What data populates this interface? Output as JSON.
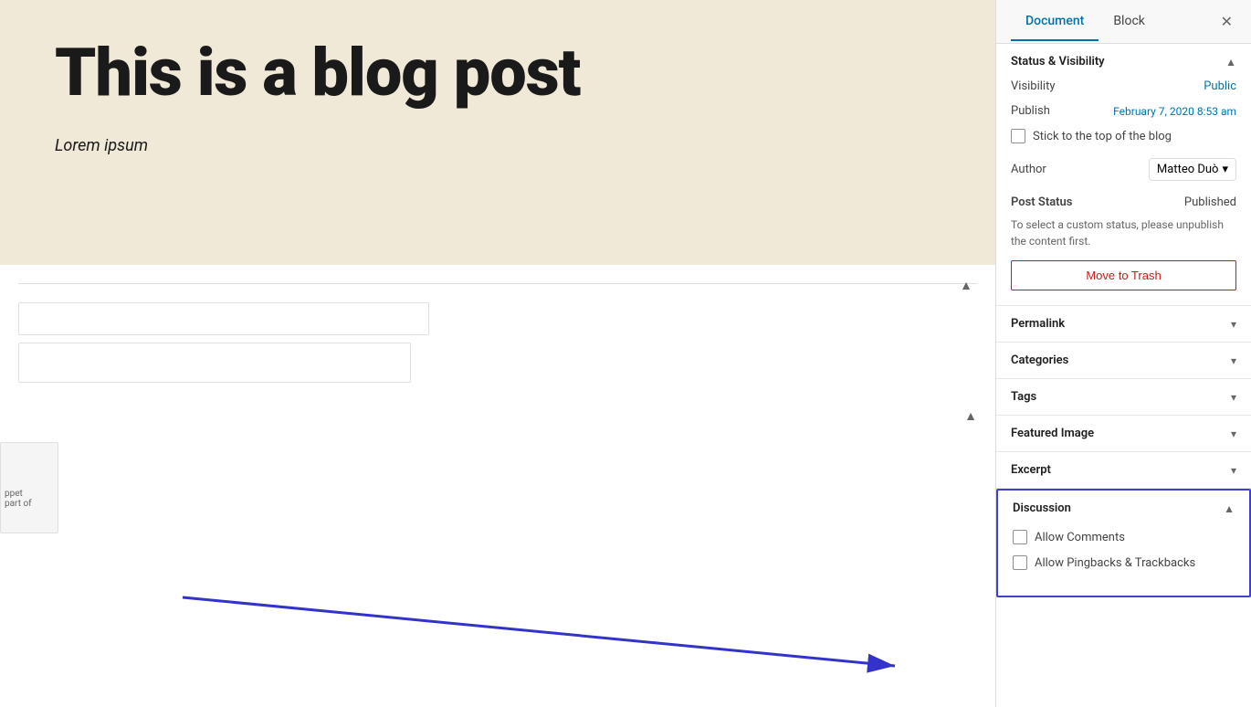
{
  "sidebar": {
    "tabs": [
      {
        "id": "document",
        "label": "Document",
        "active": true
      },
      {
        "id": "block",
        "label": "Block",
        "active": false
      }
    ],
    "close_label": "✕",
    "sections": {
      "status_visibility": {
        "title": "Status & Visibility",
        "expanded": true,
        "visibility_label": "Visibility",
        "visibility_value": "Public",
        "publish_label": "Publish",
        "publish_value": "February 7, 2020 8:53 am",
        "stick_to_top_label": "Stick to the top of the blog",
        "author_label": "Author",
        "author_value": "Matteo Duò",
        "post_status_label": "Post Status",
        "post_status_value": "Published",
        "custom_status_note": "To select a custom status, please unpublish the content first.",
        "move_to_trash_label": "Move to Trash"
      },
      "permalink": {
        "title": "Permalink",
        "expanded": false
      },
      "categories": {
        "title": "Categories",
        "expanded": false
      },
      "tags": {
        "title": "Tags",
        "expanded": false
      },
      "featured_image": {
        "title": "Featured Image",
        "expanded": false
      },
      "excerpt": {
        "title": "Excerpt",
        "expanded": false
      },
      "discussion": {
        "title": "Discussion",
        "expanded": true,
        "allow_comments_label": "Allow Comments",
        "allow_pingbacks_label": "Allow Pingbacks & Trackbacks"
      }
    }
  },
  "main": {
    "hero_title": "This is a blog post",
    "hero_subtitle": "Lorem ipsum"
  }
}
